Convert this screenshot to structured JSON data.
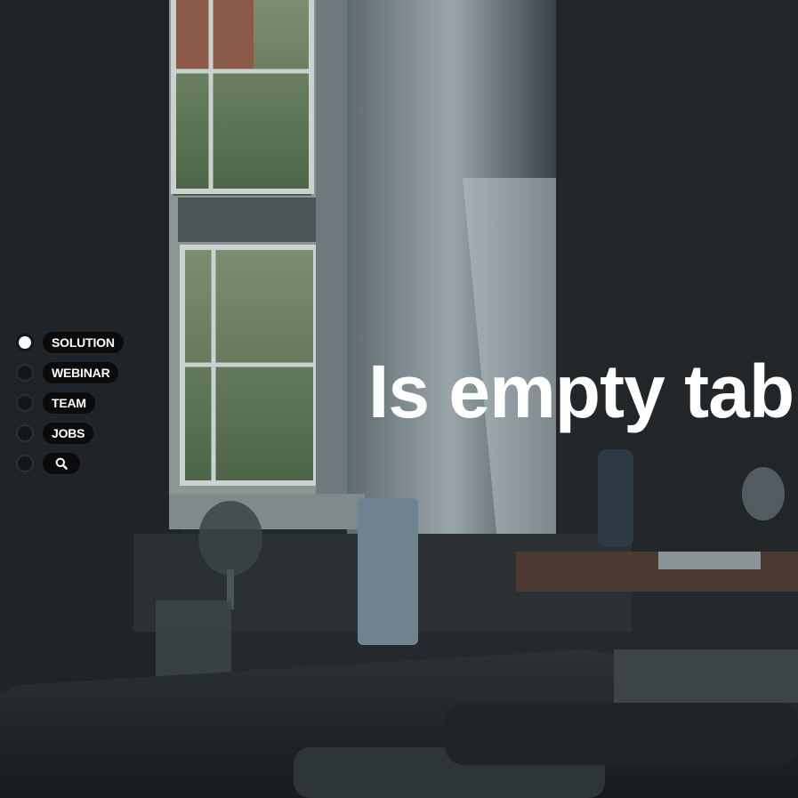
{
  "nav": {
    "items": [
      {
        "label": "SOLUTION",
        "active": true
      },
      {
        "label": "WEBINAR",
        "active": false
      },
      {
        "label": "TEAM",
        "active": false
      },
      {
        "label": "JOBS",
        "active": false
      }
    ],
    "search": {
      "icon": "search-icon"
    }
  },
  "hero": {
    "headline": "Is empty tab"
  },
  "colors": {
    "accent_text": "#ffffff",
    "pill_background": "#0b0b0c",
    "dot_inactive": "#141618",
    "dot_active": "#ffffff"
  }
}
